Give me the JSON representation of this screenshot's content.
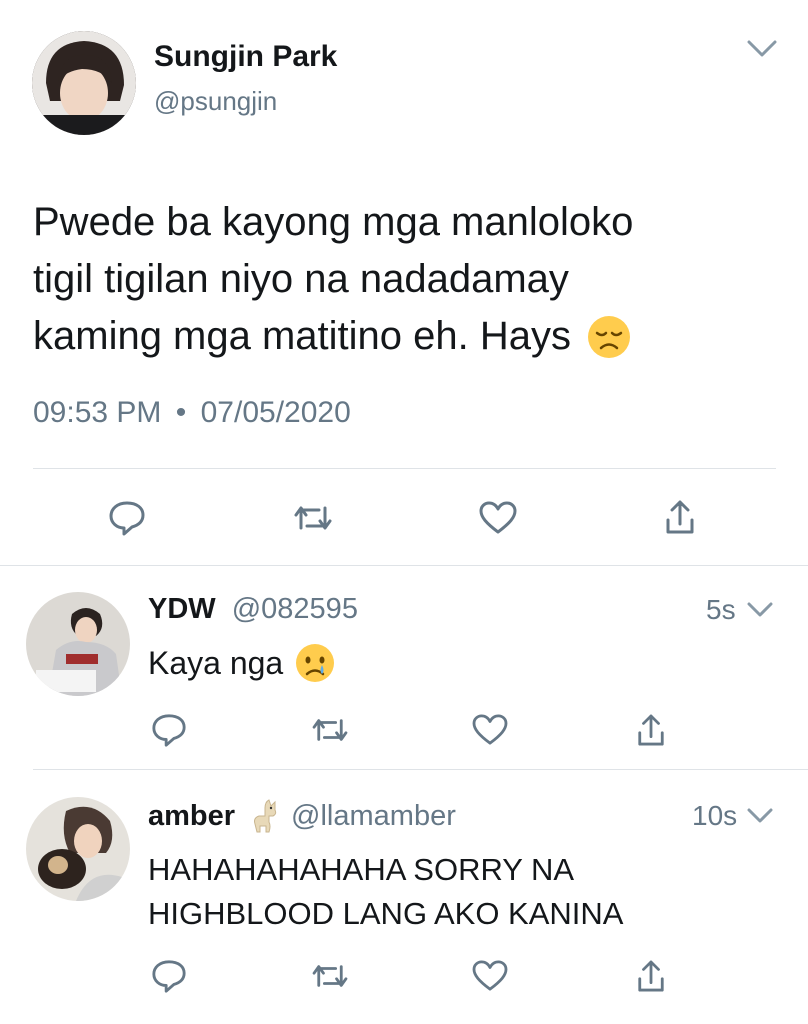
{
  "main_tweet": {
    "display_name": "Sungjin Park",
    "handle": "@psungjin",
    "text_lines": [
      "Pwede ba kayong mga manloloko",
      "tigil tigilan niyo na nadadamay",
      "kaming mga matitino eh. Hays"
    ],
    "emoji": "disappointed-face-emoji",
    "time": "09:53 PM",
    "separator": "•",
    "date": "07/05/2020"
  },
  "replies": [
    {
      "display_name": "YDW",
      "handle": "@082595",
      "age": "5s",
      "text": "Kaya nga",
      "emoji": "crying-face-emoji"
    },
    {
      "display_name": "amber",
      "name_emoji": "llama-emoji",
      "handle": "@llamamber",
      "age": "10s",
      "text_lines": [
        "HAHAHAHAHAHA SORRY NA",
        "HIGHBLOOD LANG AKO KANINA"
      ]
    }
  ],
  "actions": [
    "reply-icon",
    "retweet-icon",
    "like-icon",
    "share-icon"
  ],
  "colors": {
    "text": "#14171a",
    "secondary": "#657786",
    "icon": "#657786",
    "divider": "#dfe3e7",
    "emoji": "#ffcc4d"
  }
}
